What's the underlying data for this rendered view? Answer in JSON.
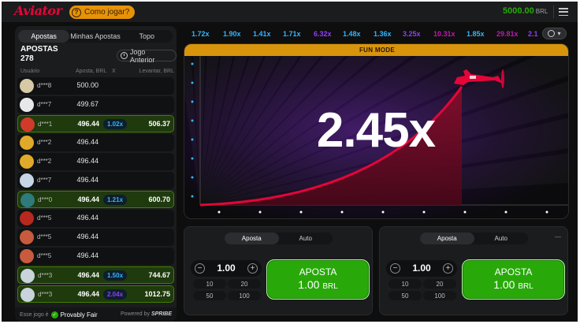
{
  "header": {
    "logo": "Aviator",
    "how_to_play": "Como jogar?",
    "balance": "5000.00",
    "currency": "BRL"
  },
  "bets_panel": {
    "tabs": [
      "Apostas",
      "Minhas Apostas",
      "Topo"
    ],
    "active_tab": 0,
    "title": "APOSTAS",
    "count": "278",
    "previous_game": "Jogo Anterior",
    "columns": {
      "user": "Usuário",
      "bet": "Aposta, BRL",
      "x": "X",
      "cashout": "Levantar, BRL"
    },
    "rows": [
      {
        "user": "d***8",
        "bet": "500.00",
        "mult": "",
        "win": "",
        "won": false,
        "avatar": "#d7c8a6"
      },
      {
        "user": "d***7",
        "bet": "499.67",
        "mult": "",
        "win": "",
        "won": false,
        "avatar": "#e8e8e8"
      },
      {
        "user": "d***1",
        "bet": "496.44",
        "mult": "1.02x",
        "win": "506.37",
        "won": true,
        "avatar": "#d03a2b"
      },
      {
        "user": "d***2",
        "bet": "496.44",
        "mult": "",
        "win": "",
        "won": false,
        "avatar": "#e0a92a"
      },
      {
        "user": "d***2",
        "bet": "496.44",
        "mult": "",
        "win": "",
        "won": false,
        "avatar": "#e0a92a"
      },
      {
        "user": "d***7",
        "bet": "496.44",
        "mult": "",
        "win": "",
        "won": false,
        "avatar": "#c6d6e6"
      },
      {
        "user": "d***0",
        "bet": "496.44",
        "mult": "1.21x",
        "win": "600.70",
        "won": true,
        "avatar": "#2f7a7a"
      },
      {
        "user": "d***5",
        "bet": "496.44",
        "mult": "",
        "win": "",
        "won": false,
        "avatar": "#b7281f"
      },
      {
        "user": "d***5",
        "bet": "496.44",
        "mult": "",
        "win": "",
        "won": false,
        "avatar": "#c85a3d"
      },
      {
        "user": "d***5",
        "bet": "496.44",
        "mult": "",
        "win": "",
        "won": false,
        "avatar": "#c85a3d"
      },
      {
        "user": "d***3",
        "bet": "496.44",
        "mult": "1.50x",
        "win": "744.67",
        "won": true,
        "avatar": "#c9d3dc"
      },
      {
        "user": "d***3",
        "bet": "496.44",
        "mult": "2.04x",
        "win": "1012.75",
        "won": true,
        "avatar": "#c9d3dc"
      }
    ],
    "footer": {
      "text": "Esse jogo é",
      "provably_fair": "Provably Fair",
      "powered_by": "Powered by",
      "brand": "SPRIBE"
    }
  },
  "history": [
    {
      "value": "1.72x",
      "color": "#34b4ff"
    },
    {
      "value": "1.90x",
      "color": "#34b4ff"
    },
    {
      "value": "1.41x",
      "color": "#34b4ff"
    },
    {
      "value": "1.71x",
      "color": "#34b4ff"
    },
    {
      "value": "6.32x",
      "color": "#913ef8"
    },
    {
      "value": "1.48x",
      "color": "#34b4ff"
    },
    {
      "value": "1.36x",
      "color": "#34b4ff"
    },
    {
      "value": "3.25x",
      "color": "#913ef8"
    },
    {
      "value": "10.31x",
      "color": "#c017b4"
    },
    {
      "value": "1.85x",
      "color": "#34b4ff"
    },
    {
      "value": "29.81x",
      "color": "#c017b4"
    },
    {
      "value": "2.1",
      "color": "#913ef8"
    }
  ],
  "game": {
    "mode_label": "FUN MODE",
    "multiplier": "2.45x"
  },
  "bet_panels": [
    {
      "tabs": [
        "Aposta",
        "Auto"
      ],
      "amount": "1.00",
      "quick": [
        "10",
        "20",
        "50",
        "100"
      ],
      "button_line1": "APOSTA",
      "button_amount": "1.00",
      "button_currency": "BRL",
      "more": ""
    },
    {
      "tabs": [
        "Aposta",
        "Auto"
      ],
      "amount": "1.00",
      "quick": [
        "10",
        "20",
        "50",
        "100"
      ],
      "button_line1": "APOSTA",
      "button_amount": "1.00",
      "button_currency": "BRL",
      "more": "—"
    }
  ]
}
